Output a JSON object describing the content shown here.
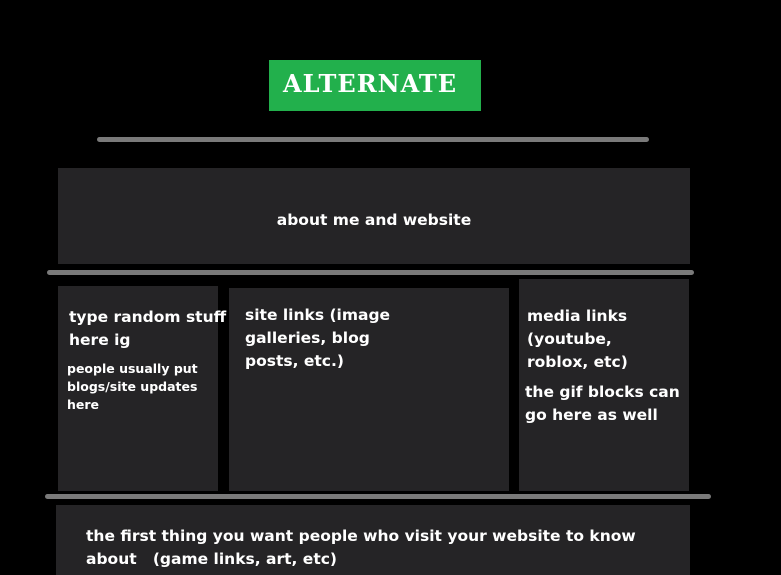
{
  "header": {
    "title": "ALTERNATE"
  },
  "about_panel": {
    "text": "about me and website"
  },
  "left_panel": {
    "heading": "type random stuff here ig",
    "subtext": "people usually put blogs/site updates here"
  },
  "middle_panel": {
    "text": "site links (image galleries, blog posts, etc.)"
  },
  "right_panel": {
    "heading": "media links (youtube, roblox, etc)",
    "subtext": "the gif blocks can go here as well"
  },
  "bottom_panel": {
    "text": "the first thing you want people who visit your website to know about   (game links, art, etc)"
  },
  "colors": {
    "background": "#000000",
    "title_box": "#22b04c",
    "panel": "#252426",
    "divider": "#7a7a7a",
    "text": "#ffffff"
  }
}
